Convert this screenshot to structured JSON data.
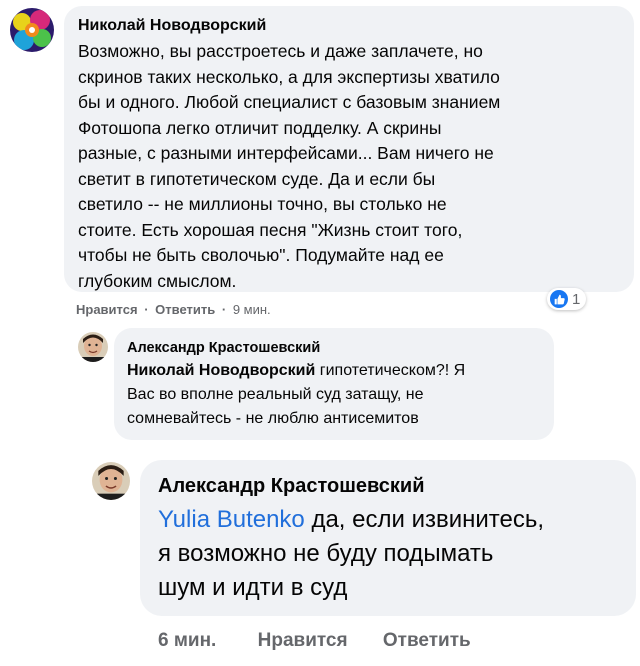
{
  "comment1": {
    "author": "Николай Новодворский",
    "lines": [
      "Возможно, вы расстроетесь и даже заплачете, но",
      "скринов таких несколько, а для экспертизы хватило",
      "бы и одного. Любой специалист с базовым знанием",
      "Фотошопа легко отличит подделку. А скрины",
      "разные, с разными интерфейсами... Вам ничего не",
      "светит в гипотетическом суде. Да и если бы",
      "светило -- не миллионы точно, вы столько не",
      "стоите. Есть хорошая песня \"Жизнь стоит того,",
      "чтобы не быть сволочью\". Подумайте над ее",
      "глубоким смыслом."
    ],
    "like_label": "Нравится",
    "sep1": "·",
    "reply_label": "Ответить",
    "sep2": "·",
    "time": "9 мин.",
    "reaction_count": "1"
  },
  "comment2": {
    "author": "Александр Крастошевский",
    "mention": "Николай Новодворский",
    "first_line_rest": " гипотетическом?! Я",
    "lines": [
      "Вас во вполне реальный суд затащу, не",
      "сомневайтесь - не люблю антисемитов"
    ]
  },
  "comment3": {
    "author": "Александр Крастошевский",
    "mention": "Yulia Butenko",
    "first_line_rest": " да, если извинитесь,",
    "lines": [
      "я возможно не буду подымать",
      "шум и идти в суд"
    ],
    "time": "6 мин.",
    "like_label": "Нравится",
    "reply_label": "Ответить"
  },
  "colors": {
    "bubble": "#f0f2f5",
    "link": "#216fdb",
    "meta": "#65676b",
    "like_blue": "#1877f2"
  }
}
